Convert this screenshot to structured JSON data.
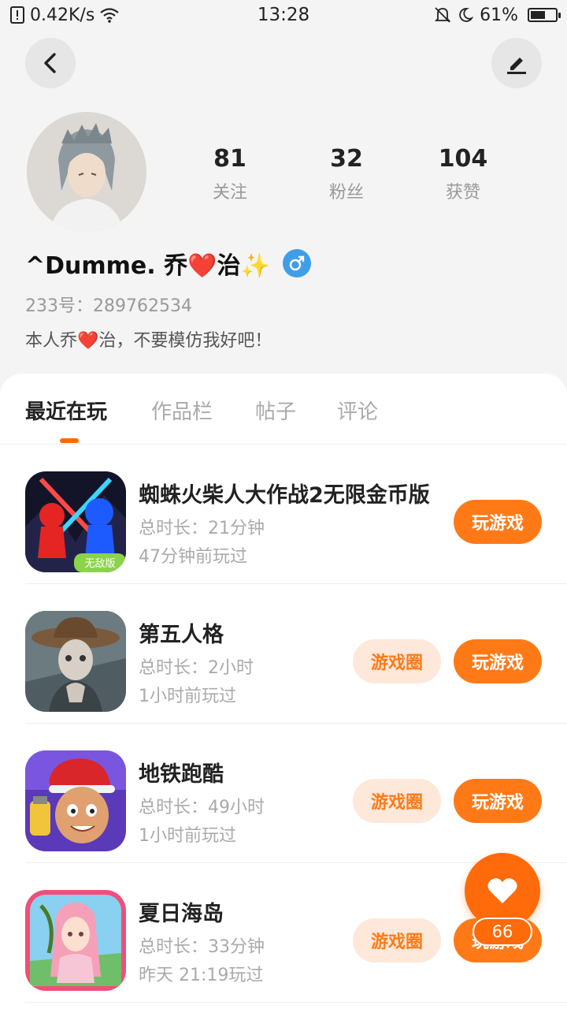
{
  "status_bar": {
    "network_speed": "0.42K/s",
    "time": "13:28",
    "battery_percent": "61%",
    "battery_level": 0.61
  },
  "profile": {
    "stats": [
      {
        "value": "81",
        "label": "关注"
      },
      {
        "value": "32",
        "label": "粉丝"
      },
      {
        "value": "104",
        "label": "获赞"
      }
    ],
    "nickname": "^Dumme. 乔❤️治✨",
    "uid": "233号：289762534",
    "bio": "本人乔❤️治，不要模仿我好吧！"
  },
  "tabs": [
    {
      "label": "最近在玩",
      "active": true
    },
    {
      "label": "作品栏",
      "active": false
    },
    {
      "label": "帖子",
      "active": false
    },
    {
      "label": "评论",
      "active": false
    }
  ],
  "games": [
    {
      "title": "蜘蛛火柴人大作战2无限金币版",
      "duration": "总时长：21分钟",
      "last_played": "47分钟前玩过",
      "badge": "无敌版",
      "has_circle": false
    },
    {
      "title": "第五人格",
      "duration": "总时长：2小时",
      "last_played": "1小时前玩过",
      "has_circle": true
    },
    {
      "title": "地铁跑酷",
      "duration": "总时长：49小时",
      "last_played": "1小时前玩过",
      "has_circle": true
    },
    {
      "title": "夏日海岛",
      "duration": "总时长：33分钟",
      "last_played": "昨天 21:19玩过",
      "has_circle": true
    }
  ],
  "buttons": {
    "play": "玩游戏",
    "circle": "游戏圈"
  },
  "fab": {
    "count": "66"
  },
  "colors": {
    "accent": "#ff7a17",
    "accent_light": "#fde8da",
    "gender_blue": "#3f9ee8"
  }
}
